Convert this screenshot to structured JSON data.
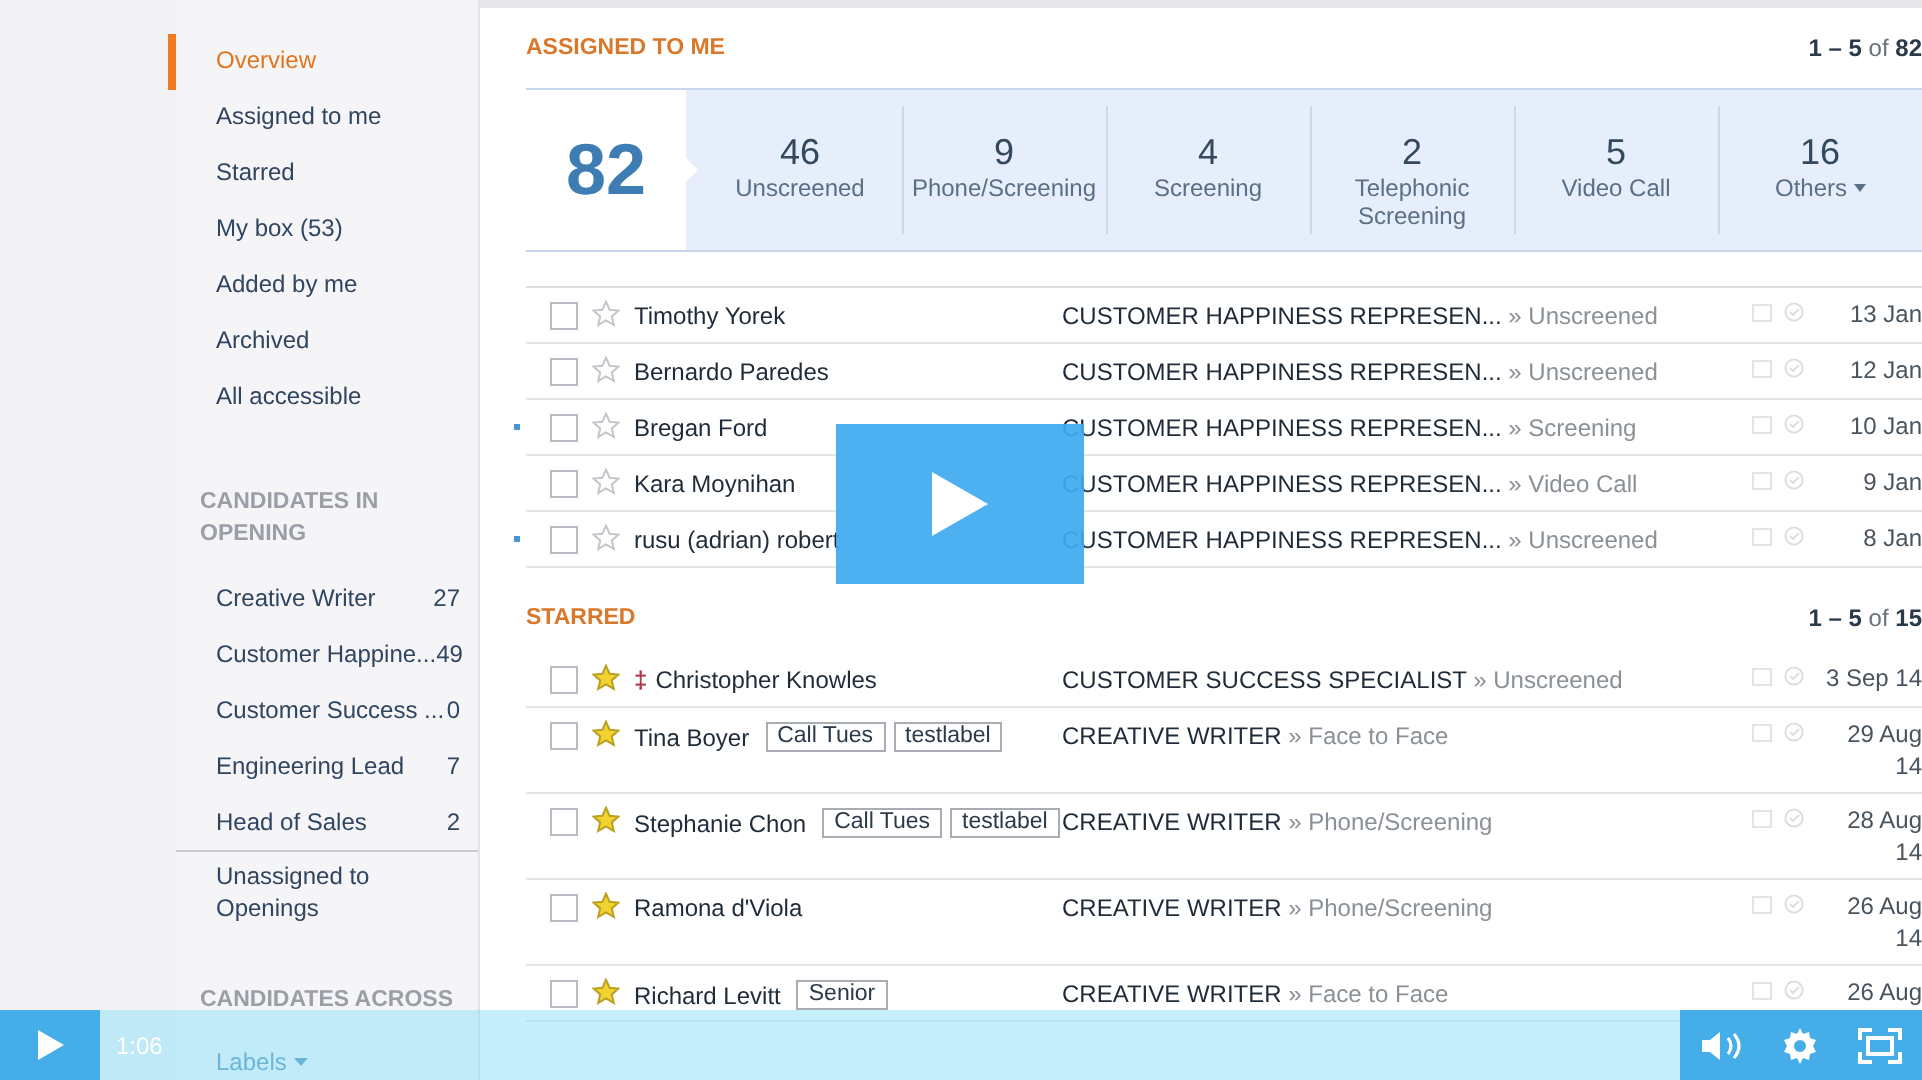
{
  "sidebar": {
    "nav": [
      {
        "label": "Overview",
        "selected": true
      },
      {
        "label": "Assigned to me",
        "selected": false
      },
      {
        "label": "Starred",
        "selected": false
      },
      {
        "label": "My box (53)",
        "selected": false
      },
      {
        "label": "Added by me",
        "selected": false
      },
      {
        "label": "Archived",
        "selected": false
      },
      {
        "label": "All accessible",
        "selected": false
      }
    ],
    "openings_heading": "CANDIDATES IN OPENING",
    "openings": [
      {
        "label": "Creative Writer",
        "count": "27"
      },
      {
        "label": "Customer Happine...",
        "count": "49"
      },
      {
        "label": "Customer Success ...",
        "count": "0"
      },
      {
        "label": "Engineering Lead",
        "count": "7"
      },
      {
        "label": "Head of Sales",
        "count": "2"
      }
    ],
    "unassigned": "Unassigned to Openings",
    "across_heading": "CANDIDATES ACROSS",
    "labels_menu": "Labels"
  },
  "sections": [
    {
      "title": "ASSIGNED TO ME",
      "range": "**1 – 5** of **82**",
      "total": "82",
      "stages": [
        {
          "count": "46",
          "label": "Unscreened",
          "dropdown": false
        },
        {
          "count": "9",
          "label": "Phone/Screening",
          "dropdown": false
        },
        {
          "count": "4",
          "label": "Screening",
          "dropdown": false
        },
        {
          "count": "2",
          "label": "Telephonic Screening",
          "dropdown": false
        },
        {
          "count": "5",
          "label": "Video Call",
          "dropdown": false
        },
        {
          "count": "16",
          "label": "Others",
          "dropdown": true
        }
      ],
      "rows": [
        {
          "marked": false,
          "checked": false,
          "starred": false,
          "name": "Timothy Yorek",
          "tags": [],
          "opening": "CUSTOMER HAPPINESS REPRESEN...",
          "stage": "» Unscreened",
          "date": "13 Jan"
        },
        {
          "marked": false,
          "checked": false,
          "starred": false,
          "name": "Bernardo Paredes",
          "tags": [],
          "opening": "CUSTOMER HAPPINESS REPRESEN...",
          "stage": "» Unscreened",
          "date": "12 Jan"
        },
        {
          "marked": true,
          "checked": false,
          "starred": false,
          "name": "Bregan Ford",
          "tags": [],
          "opening": "CUSTOMER HAPPINESS REPRESEN...",
          "stage": "» Screening",
          "date": "10 Jan"
        },
        {
          "marked": false,
          "checked": false,
          "starred": false,
          "name": "Kara Moynihan",
          "tags": [],
          "opening": "CUSTOMER HAPPINESS REPRESEN...",
          "stage": "» Video Call",
          "date": "9 Jan"
        },
        {
          "marked": true,
          "checked": false,
          "starred": false,
          "name": "rusu (adrian) robert",
          "tags": [],
          "opening": "CUSTOMER HAPPINESS REPRESEN...",
          "stage": "» Unscreened",
          "date": "8 Jan"
        }
      ]
    },
    {
      "title": "STARRED",
      "range": "**1 – 5** of **15**",
      "rows": [
        {
          "marked": false,
          "checked": false,
          "starred": true,
          "flag": "‡",
          "name": "Christopher Knowles",
          "tags": [],
          "opening": "CUSTOMER SUCCESS SPECIALIST",
          "stage": "» Unscreened",
          "date": "3 Sep 14"
        },
        {
          "marked": false,
          "checked": false,
          "starred": true,
          "name": "Tina Boyer",
          "tags": [
            "Call Tues",
            "testlabel"
          ],
          "opening": "CREATIVE WRITER",
          "stage": "» Face to Face",
          "date": "29 Aug 14"
        },
        {
          "marked": false,
          "checked": false,
          "starred": true,
          "name": "Stephanie Chon",
          "tags": [
            "Call Tues",
            "testlabel"
          ],
          "opening": "CREATIVE WRITER",
          "stage": "» Phone/Screening",
          "date": "28 Aug 14"
        },
        {
          "marked": false,
          "checked": false,
          "starred": true,
          "name": "Ramona d'Viola",
          "tags": [],
          "opening": "CREATIVE WRITER",
          "stage": "» Phone/Screening",
          "date": "26 Aug 14"
        },
        {
          "marked": false,
          "checked": false,
          "starred": true,
          "name": "Richard Levitt",
          "tags": [
            "Senior"
          ],
          "opening": "CREATIVE WRITER",
          "stage": "» Face to Face",
          "date": "26 Aug"
        }
      ]
    }
  ],
  "video": {
    "time": "1:06"
  }
}
